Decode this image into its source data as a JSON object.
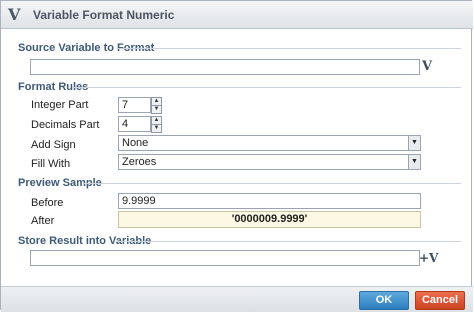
{
  "window": {
    "title": "Variable Format Numeric",
    "logo_glyph": "V"
  },
  "source": {
    "section_title": "Source Variable to Format",
    "value": "",
    "var_button_glyph": "V"
  },
  "format_rules": {
    "section_title": "Format Rules",
    "integer_part": {
      "label": "Integer Part",
      "value": "7"
    },
    "decimals_part": {
      "label": "Decimals Part",
      "value": "4"
    },
    "add_sign": {
      "label": "Add Sign",
      "value": "None"
    },
    "fill_with": {
      "label": "Fill With",
      "value": "Zeroes"
    }
  },
  "preview": {
    "section_title": "Preview Sample",
    "before": {
      "label": "Before",
      "value": "9.9999"
    },
    "after": {
      "label": "After",
      "value": "'0000009.9999'"
    }
  },
  "store": {
    "section_title": "Store Result into Variable",
    "value": "",
    "var_button_glyph": "+V"
  },
  "buttons": {
    "ok": "OK",
    "cancel": "Cancel"
  },
  "icons": {
    "spinner_up": "▲",
    "spinner_down": "▼",
    "dropdown": "▼"
  }
}
